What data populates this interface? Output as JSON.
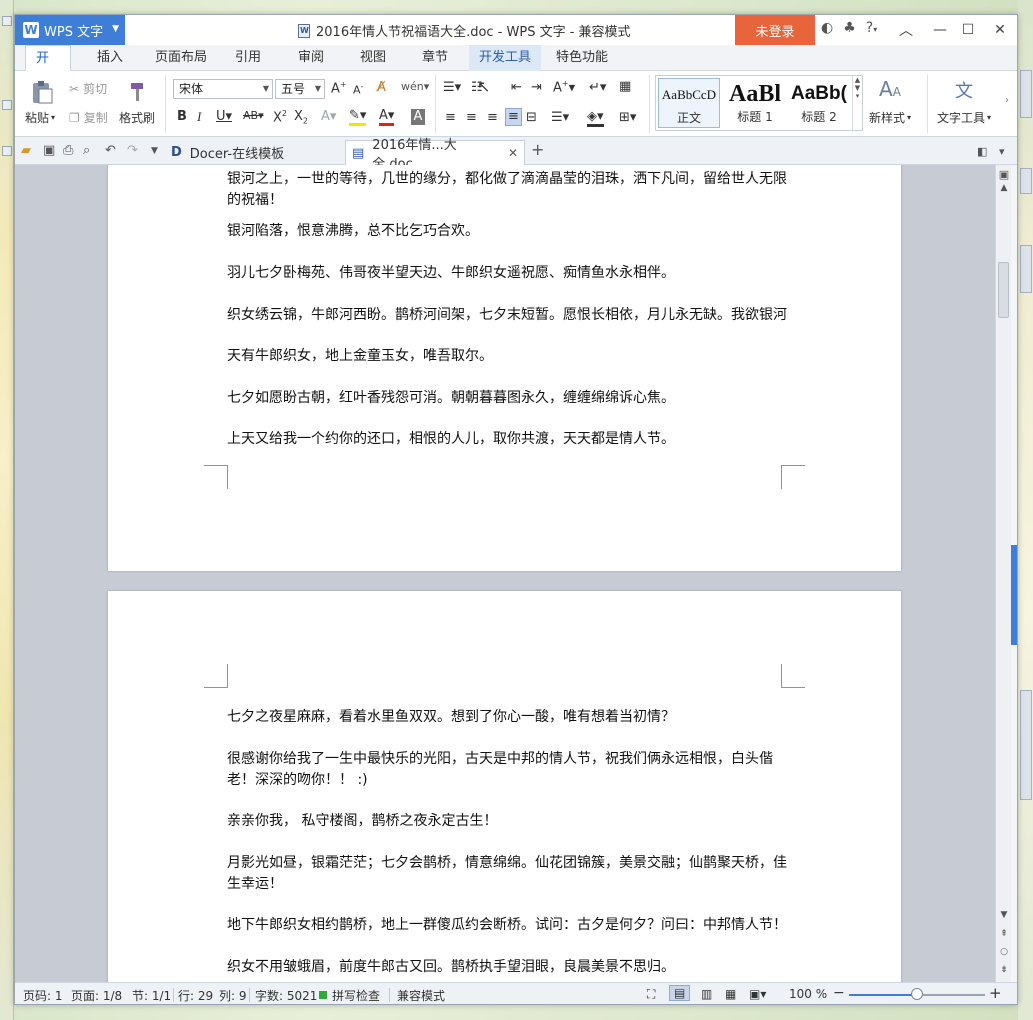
{
  "window": {
    "app_name": "WPS 文字",
    "doc_title": "2016年情人节祝福语大全.doc - WPS 文字 - 兼容模式",
    "login_label": "未登录",
    "help_label": "?"
  },
  "tabs": [
    "开始",
    "插入",
    "页面布局",
    "引用",
    "审阅",
    "视图",
    "章节",
    "开发工具",
    "特色功能"
  ],
  "ribbon": {
    "paste": "粘贴",
    "cut": "剪切",
    "copy": "复制",
    "format_painter": "格式刷",
    "font_name": "宋体",
    "font_size": "五号",
    "styles": [
      {
        "sample": "AaBbCcD",
        "label": "正文"
      },
      {
        "sample": "AaBl",
        "label": "标题 1"
      },
      {
        "sample": "AaBb(",
        "label": "标题 2"
      }
    ],
    "new_style": "新样式",
    "text_tools": "文字工具"
  },
  "doc_tabs": [
    {
      "label": "Docer-在线模板"
    },
    {
      "label": "2016年情...大全.doc"
    }
  ],
  "page1_paragraphs": [
    "银河之上，一世的等待，几世的缘分，都化做了滴滴晶莹的泪珠，洒下凡间，留给世人无限的祝福！",
    "银河陷落，恨意沸腾，总不比乞巧合欢。",
    "羽儿七夕卧梅苑、伟哥夜半望天边、牛郎织女遥祝愿、痴情鱼水永相伴。",
    "织女绣云锦，牛郎河西盼。鹊桥河间架，七夕末短暂。愿恨长相依，月儿永无缺。我欲银河",
    "天有牛郎织女，地上金童玉女，唯吾取尔。",
    "七夕如愿盼古朝，红叶香残怨可消。朝朝暮暮图永久，缠缠绵绵诉心焦。",
    "上天又给我一个约你的还口，相恨的人儿，取你共渡，天天都是情人节。"
  ],
  "page2_paragraphs": [
    "七夕之夜星麻麻，看着水里鱼双双。想到了你心一酸，唯有想着当初情？",
    "很感谢你给我了一生中最快乐的光阳，古天是中邦的情人节，祝我们俩永远相恨，白头偕老！深深的吻你！！ :)",
    "亲亲你我， 私守楼阁，鹊桥之夜永定古生！",
    "月影光如昼，银霜茫茫；七夕会鹊桥，情意绵绵。仙花团锦簇，美景交融；仙鹊聚天桥，佳生幸运！",
    "地下牛郎织女相约鹊桥，地上一群傻瓜约会断桥。试问：古夕是何夕？问曰：中邦情人节！",
    "织女不用皱蛾眉，前度牛郎古又回。鹊桥执手望泪眼，良晨美景不思归。"
  ],
  "status": {
    "page_code": "页码: 1",
    "page": "页面: 1/8",
    "section": "节: 1/1",
    "row": "行: 29",
    "col": "列: 9",
    "word_count": "字数: 5021",
    "spell_check": "拼写检查",
    "compat_mode": "兼容模式",
    "zoom": "100 %",
    "zoom_fraction": 0.5
  },
  "colors": {
    "accent": "#3f7ed6",
    "login": "#e8643b",
    "spell_ok": "#2eaa3c"
  }
}
